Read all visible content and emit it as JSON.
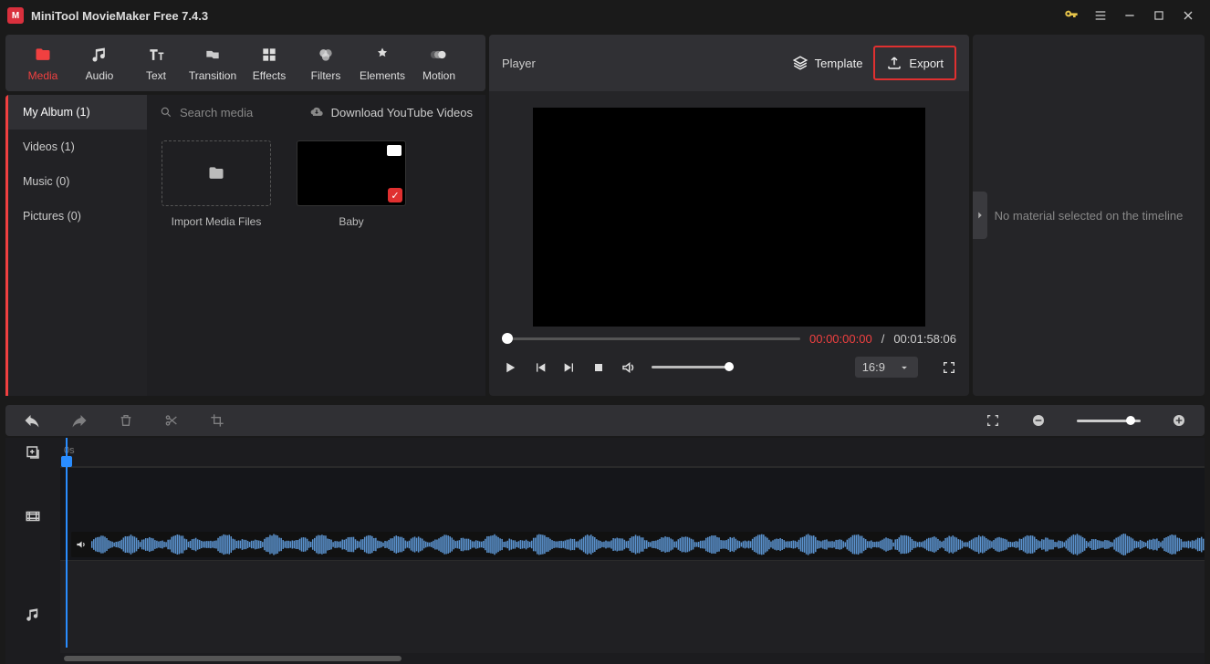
{
  "app": {
    "title": "MiniTool MovieMaker Free 7.4.3",
    "logo": "M"
  },
  "tools": [
    {
      "label": "Media"
    },
    {
      "label": "Audio"
    },
    {
      "label": "Text"
    },
    {
      "label": "Transition"
    },
    {
      "label": "Effects"
    },
    {
      "label": "Filters"
    },
    {
      "label": "Elements"
    },
    {
      "label": "Motion"
    }
  ],
  "sidebar": {
    "items": [
      {
        "label": "My Album (1)"
      },
      {
        "label": "Videos (1)"
      },
      {
        "label": "Music (0)"
      },
      {
        "label": "Pictures (0)"
      }
    ]
  },
  "media_top": {
    "search_placeholder": "Search media",
    "download_label": "Download YouTube Videos"
  },
  "tiles": {
    "import": "Import Media Files",
    "video1": "Baby"
  },
  "player": {
    "title": "Player",
    "template": "Template",
    "export": "Export",
    "time_current": "00:00:00:00",
    "time_total": "00:01:58:06",
    "aspect": "16:9"
  },
  "right": {
    "empty": "No material selected on the timeline"
  },
  "timeline": {
    "ruler_start": "0s"
  }
}
